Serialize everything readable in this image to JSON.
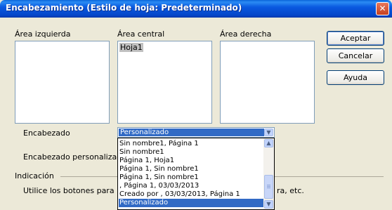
{
  "window": {
    "title": "Encabezamiento (Estilo de hoja: Predeterminado)"
  },
  "areas": {
    "left_label": "Área izquierda",
    "center_label": "Área central",
    "right_label": "Área derecha",
    "left_text": "",
    "center_text": "Hoja1",
    "right_text": ""
  },
  "buttons": {
    "accept": "Aceptar",
    "cancel": "Cancelar",
    "help": "Ayuda"
  },
  "header": {
    "label": "Encabezado",
    "custom_label": "Encabezado personalizado",
    "selected": "Personalizado",
    "options": [
      "Sin nombre1, Página 1",
      "Sin nombre1",
      "Página 1, Hoja1",
      "Página 1, Sin nombre1",
      "Página 1, Sin nombre1",
      ", Página 1, 03/03/2013",
      "Creado por  , 03/03/2013, Página 1",
      "Personalizado"
    ]
  },
  "hint": {
    "title": "Indicación",
    "text_start": "Utilice los botones para modifica",
    "text_end": "ra, etc."
  },
  "colors": {
    "titlebar": "#0546c8",
    "selection": "#316ac5",
    "dialog_bg": "#ece9d8"
  },
  "icons": {
    "close": "close-icon",
    "dropdown": "chevron-down-icon",
    "scroll_up": "chevron-up-icon",
    "scroll_down": "chevron-down-icon"
  }
}
